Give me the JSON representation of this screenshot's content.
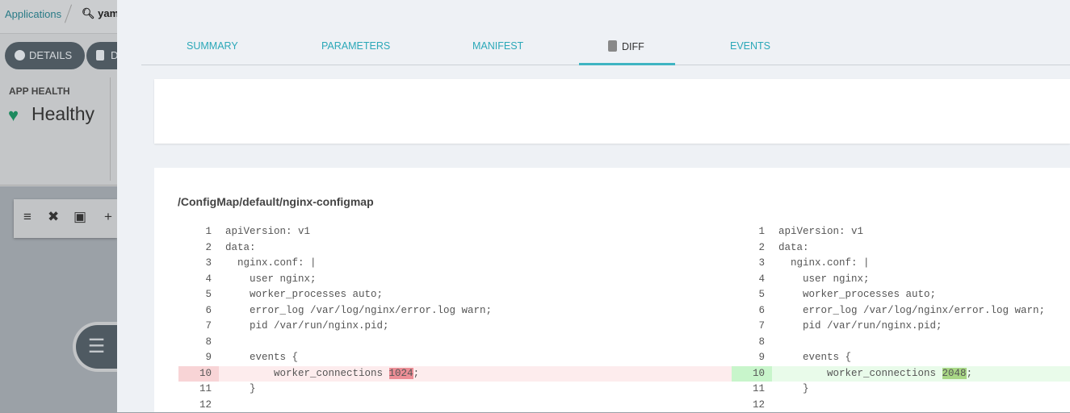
{
  "background": {
    "breadcrumb": {
      "root": "Applications",
      "search": "yaml"
    },
    "buttons": [
      {
        "label": "DETAILS",
        "icon": "info-icon"
      },
      {
        "label": "DI",
        "icon": "file-diff-icon"
      }
    ],
    "health": {
      "title": "APP HEALTH",
      "status": "Healthy",
      "color": "#1d8a5f"
    }
  },
  "tabs": [
    {
      "label": "SUMMARY"
    },
    {
      "label": "PARAMETERS"
    },
    {
      "label": "MANIFEST"
    },
    {
      "label": "DIFF",
      "active": true
    },
    {
      "label": "EVENTS"
    }
  ],
  "diff": {
    "resource": "/ConfigMap/default/nginx-configmap",
    "left": [
      [
        "1",
        "apiVersion: v1"
      ],
      [
        "2",
        "data:"
      ],
      [
        "3",
        "  nginx.conf: |"
      ],
      [
        "4",
        "    user nginx;"
      ],
      [
        "5",
        "    worker_processes auto;"
      ],
      [
        "6",
        "    error_log /var/log/nginx/error.log warn;"
      ],
      [
        "7",
        "    pid /var/run/nginx.pid;"
      ],
      [
        "8",
        ""
      ],
      [
        "9",
        "    events {"
      ],
      [
        "10",
        "        worker_connections ",
        "1024",
        ";"
      ],
      [
        "11",
        "    }"
      ],
      [
        "12",
        ""
      ]
    ],
    "right": [
      [
        "1",
        "apiVersion: v1"
      ],
      [
        "2",
        "data:"
      ],
      [
        "3",
        "  nginx.conf: |"
      ],
      [
        "4",
        "    user nginx;"
      ],
      [
        "5",
        "    worker_processes auto;"
      ],
      [
        "6",
        "    error_log /var/log/nginx/error.log warn;"
      ],
      [
        "7",
        "    pid /var/run/nginx.pid;"
      ],
      [
        "8",
        ""
      ],
      [
        "9",
        "    events {"
      ],
      [
        "10",
        "        worker_connections ",
        "2048",
        ";"
      ],
      [
        "11",
        "    }"
      ],
      [
        "12",
        ""
      ]
    ],
    "changed_line": "10"
  }
}
